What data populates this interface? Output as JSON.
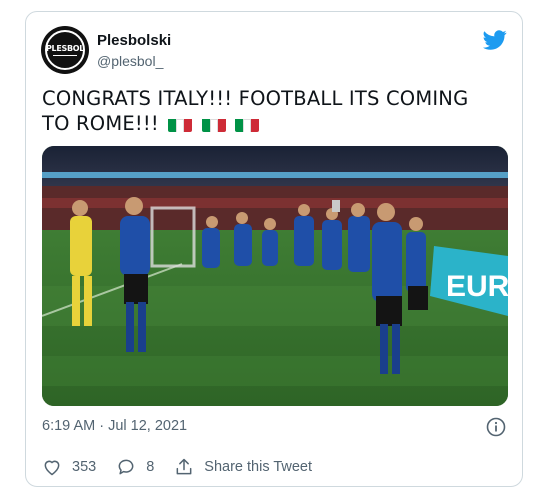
{
  "tweet": {
    "author": {
      "name": "Plesbolski",
      "handle": "@plesbol_",
      "avatar_text": "PLESBOL"
    },
    "text": "CONGRATS ITALY!!! FOOTBALL ITS COMING TO ROME!!!",
    "flag_count": 3,
    "flag_colors": [
      "#009246",
      "#ffffff",
      "#ce2b37"
    ],
    "timestamp": "6:19 AM · Jul 12, 2021",
    "likes": "353",
    "replies": "8",
    "share_label": "Share this Tweet",
    "media": {
      "type": "video-still",
      "description_icon": "celebration-photo",
      "banner_text": "EUR"
    }
  },
  "colors": {
    "twitter_blue": "#1d9bf0",
    "secondary_text": "#536471",
    "border": "#cfd9de"
  },
  "icons": [
    "twitter-bird-icon",
    "info-icon",
    "heart-icon",
    "reply-icon",
    "share-icon"
  ]
}
